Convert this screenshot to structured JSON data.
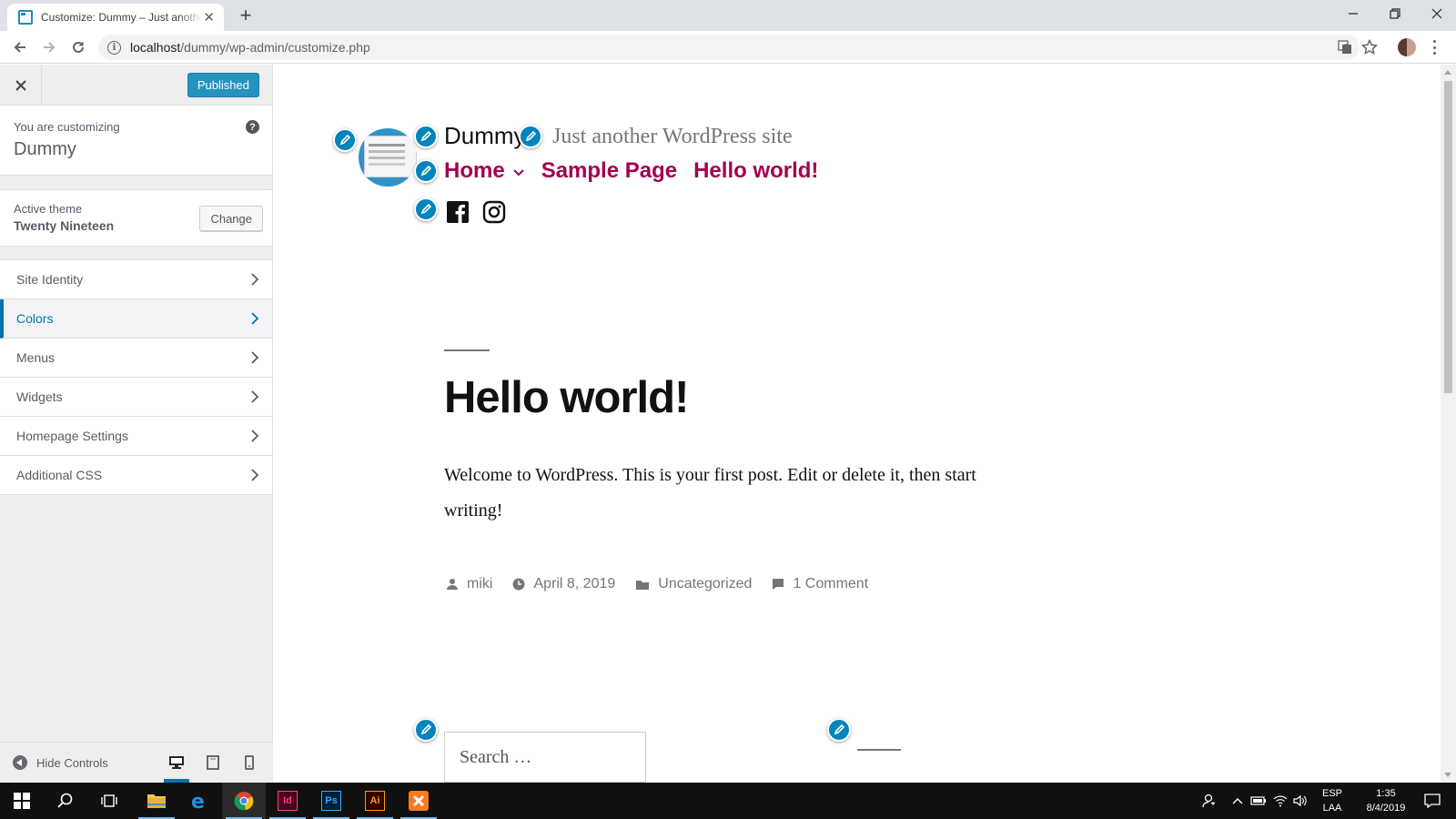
{
  "browser": {
    "tab_title": "Customize: Dummy – Just another WordPress site",
    "url_host": "localhost",
    "url_path": "/dummy/wp-admin/customize.php"
  },
  "customizer": {
    "publish_label": "Published",
    "customizing_label": "You are customizing",
    "site_name": "Dummy",
    "help_glyph": "?",
    "active_theme_label": "Active theme",
    "theme_name": "Twenty Nineteen",
    "change_label": "Change",
    "sections": [
      {
        "label": "Site Identity",
        "active": false
      },
      {
        "label": "Colors",
        "active": true
      },
      {
        "label": "Menus",
        "active": false
      },
      {
        "label": "Widgets",
        "active": false
      },
      {
        "label": "Homepage Settings",
        "active": false
      },
      {
        "label": "Additional CSS",
        "active": false
      }
    ],
    "hide_controls_label": "Hide Controls",
    "accent_color": "#0073aa"
  },
  "preview": {
    "site_title": "Dummy",
    "tagline": "Just another WordPress site",
    "nav": [
      "Home",
      "Sample Page",
      "Hello world!"
    ],
    "social_icons": [
      "facebook-icon",
      "instagram-icon"
    ],
    "post_title": "Hello world!",
    "post_content": "Welcome to WordPress. This is your first post. Edit or delete it, then start writing!",
    "meta": {
      "author": "miki",
      "date": "April 8, 2019",
      "category": "Uncategorized",
      "comments": "1 Comment"
    },
    "search_placeholder": "Search …",
    "link_color": "#a3004e"
  },
  "taskbar": {
    "apps": [
      "start",
      "search",
      "task-view",
      "file-explorer",
      "edge",
      "chrome",
      "indesign",
      "photoshop",
      "illustrator",
      "xampp"
    ],
    "indesign_label": "Id",
    "photoshop_label": "Ps",
    "illustrator_label": "Ai",
    "lang_top": "ESP",
    "lang_bottom": "LAA",
    "time": "1:35",
    "date": "8/4/2019"
  }
}
